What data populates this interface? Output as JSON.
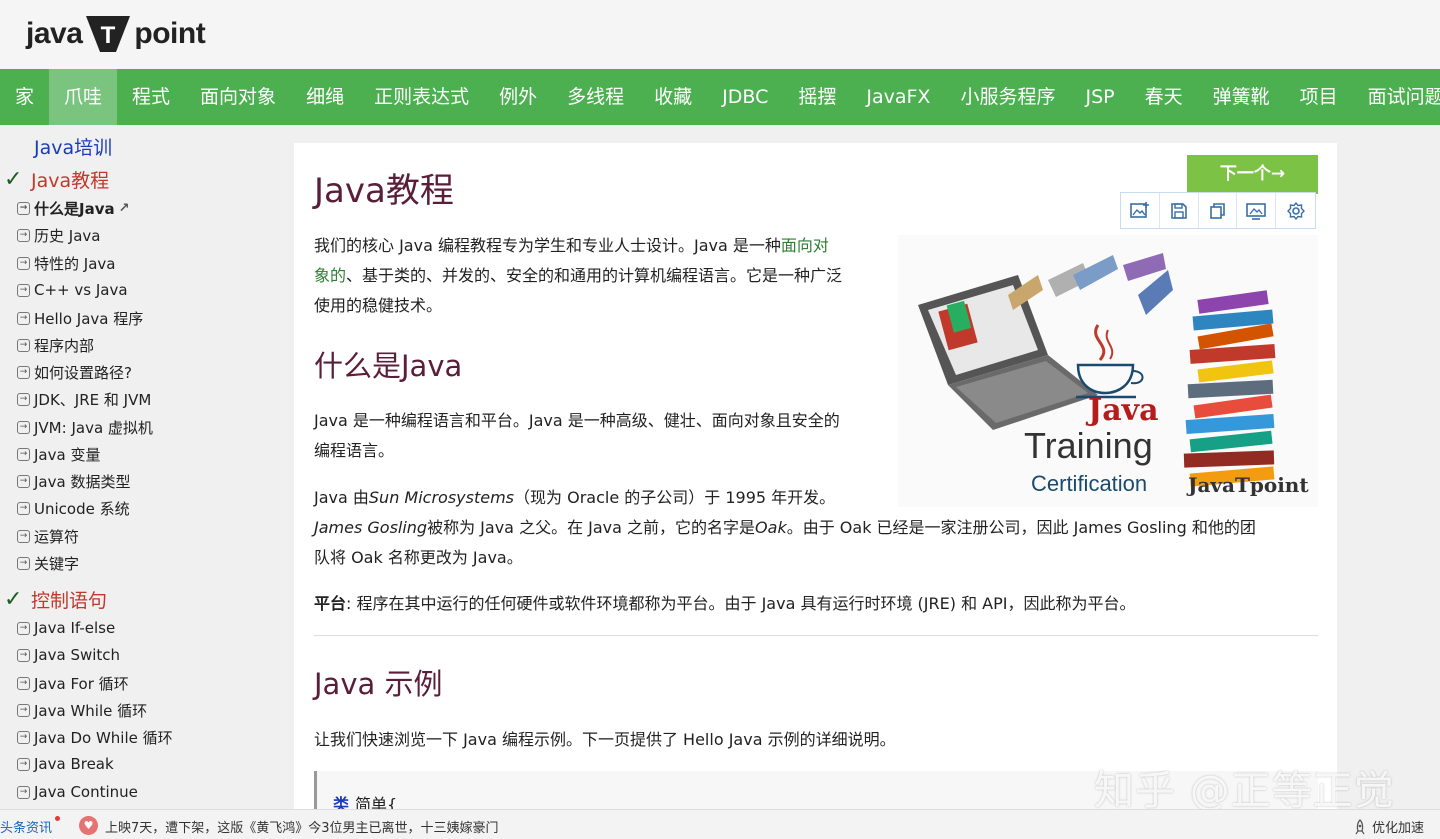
{
  "logo": {
    "left": "java",
    "right": "point",
    "t": "T"
  },
  "nav": [
    "家",
    "爪哇",
    "程式",
    "面向对象",
    "细绳",
    "正则表达式",
    "例外",
    "多线程",
    "收藏",
    "JDBC",
    "摇摆",
    "JavaFX",
    "小服务程序",
    "JSP",
    "春天",
    "弹簧靴",
    "项目",
    "面试问题"
  ],
  "sidebar": {
    "top_link": "Java培训",
    "section1": "Java教程",
    "items1": [
      "什么是Java",
      "历史 Java",
      "特性的 Java",
      "C++ vs Java",
      "Hello Java 程序",
      "程序内部",
      "如何设置路径?",
      "JDK、JRE 和 JVM",
      "JVM: Java 虚拟机",
      "Java 变量",
      "Java 数据类型",
      "Unicode 系统",
      "运算符",
      "关键字"
    ],
    "section2": "控制语句",
    "items2": [
      "Java If-else",
      "Java Switch",
      "Java For 循环",
      "Java While 循环",
      "Java Do While 循环",
      "Java Break",
      "Java Continue"
    ]
  },
  "main": {
    "title": "Java教程",
    "next_label": "下一个→",
    "intro_a": "我们的核心 Java 编程教程专为学生和专业人士设计。Java 是一种",
    "intro_link1": "面向对",
    "intro_link2": "象的",
    "intro_b": "、基于类的、并发的、安全的和通用的计算机编程语言。它是一种广泛",
    "intro_c": "使用的稳健技术。",
    "h2_what": "什么是Java",
    "what_a": "Java 是一种编程语言和平台。Java 是一种高级、健壮、面向对象且安全的",
    "what_b": "编程语言。",
    "history_a": "Java 由",
    "history_sun": "Sun Microsystems",
    "history_b": "（现为 Oracle 的子公司）于 1995 年开发。",
    "history_gosling": "James Gosling",
    "history_c": "被称为 Java 之父。在 Java 之前，它的名字是",
    "history_oak": "Oak",
    "history_d": "。由于 Oak 已经是一家注册公司，因此 James Gosling 和他的团",
    "history_e": "队将 Oak 名称更改为 Java。",
    "platform_label": "平台",
    "platform_text": ": 程序在其中运行的任何硬件或软件环境都称为平台。由于 Java 具有运行时环境 (JRE) 和 API，因此称为平台。",
    "h2_example": "Java 示例",
    "example_text": "让我们快速浏览一下 Java 编程示例。下一页提供了 Hello Java 示例的详细说明。",
    "code_kw": "类",
    "code_rest": "简单{",
    "hero": {
      "java": "Java",
      "training": "Training",
      "cert": "Certification",
      "brand": "JavaTpoint"
    }
  },
  "watermark": "知乎 @正等正觉",
  "statusbar": {
    "news": "头条资讯",
    "headline": "上映7天，遭下架，这版《黄飞鸿》今3位男主已离世，十三姨嫁豪门",
    "speed": "优化加速"
  }
}
